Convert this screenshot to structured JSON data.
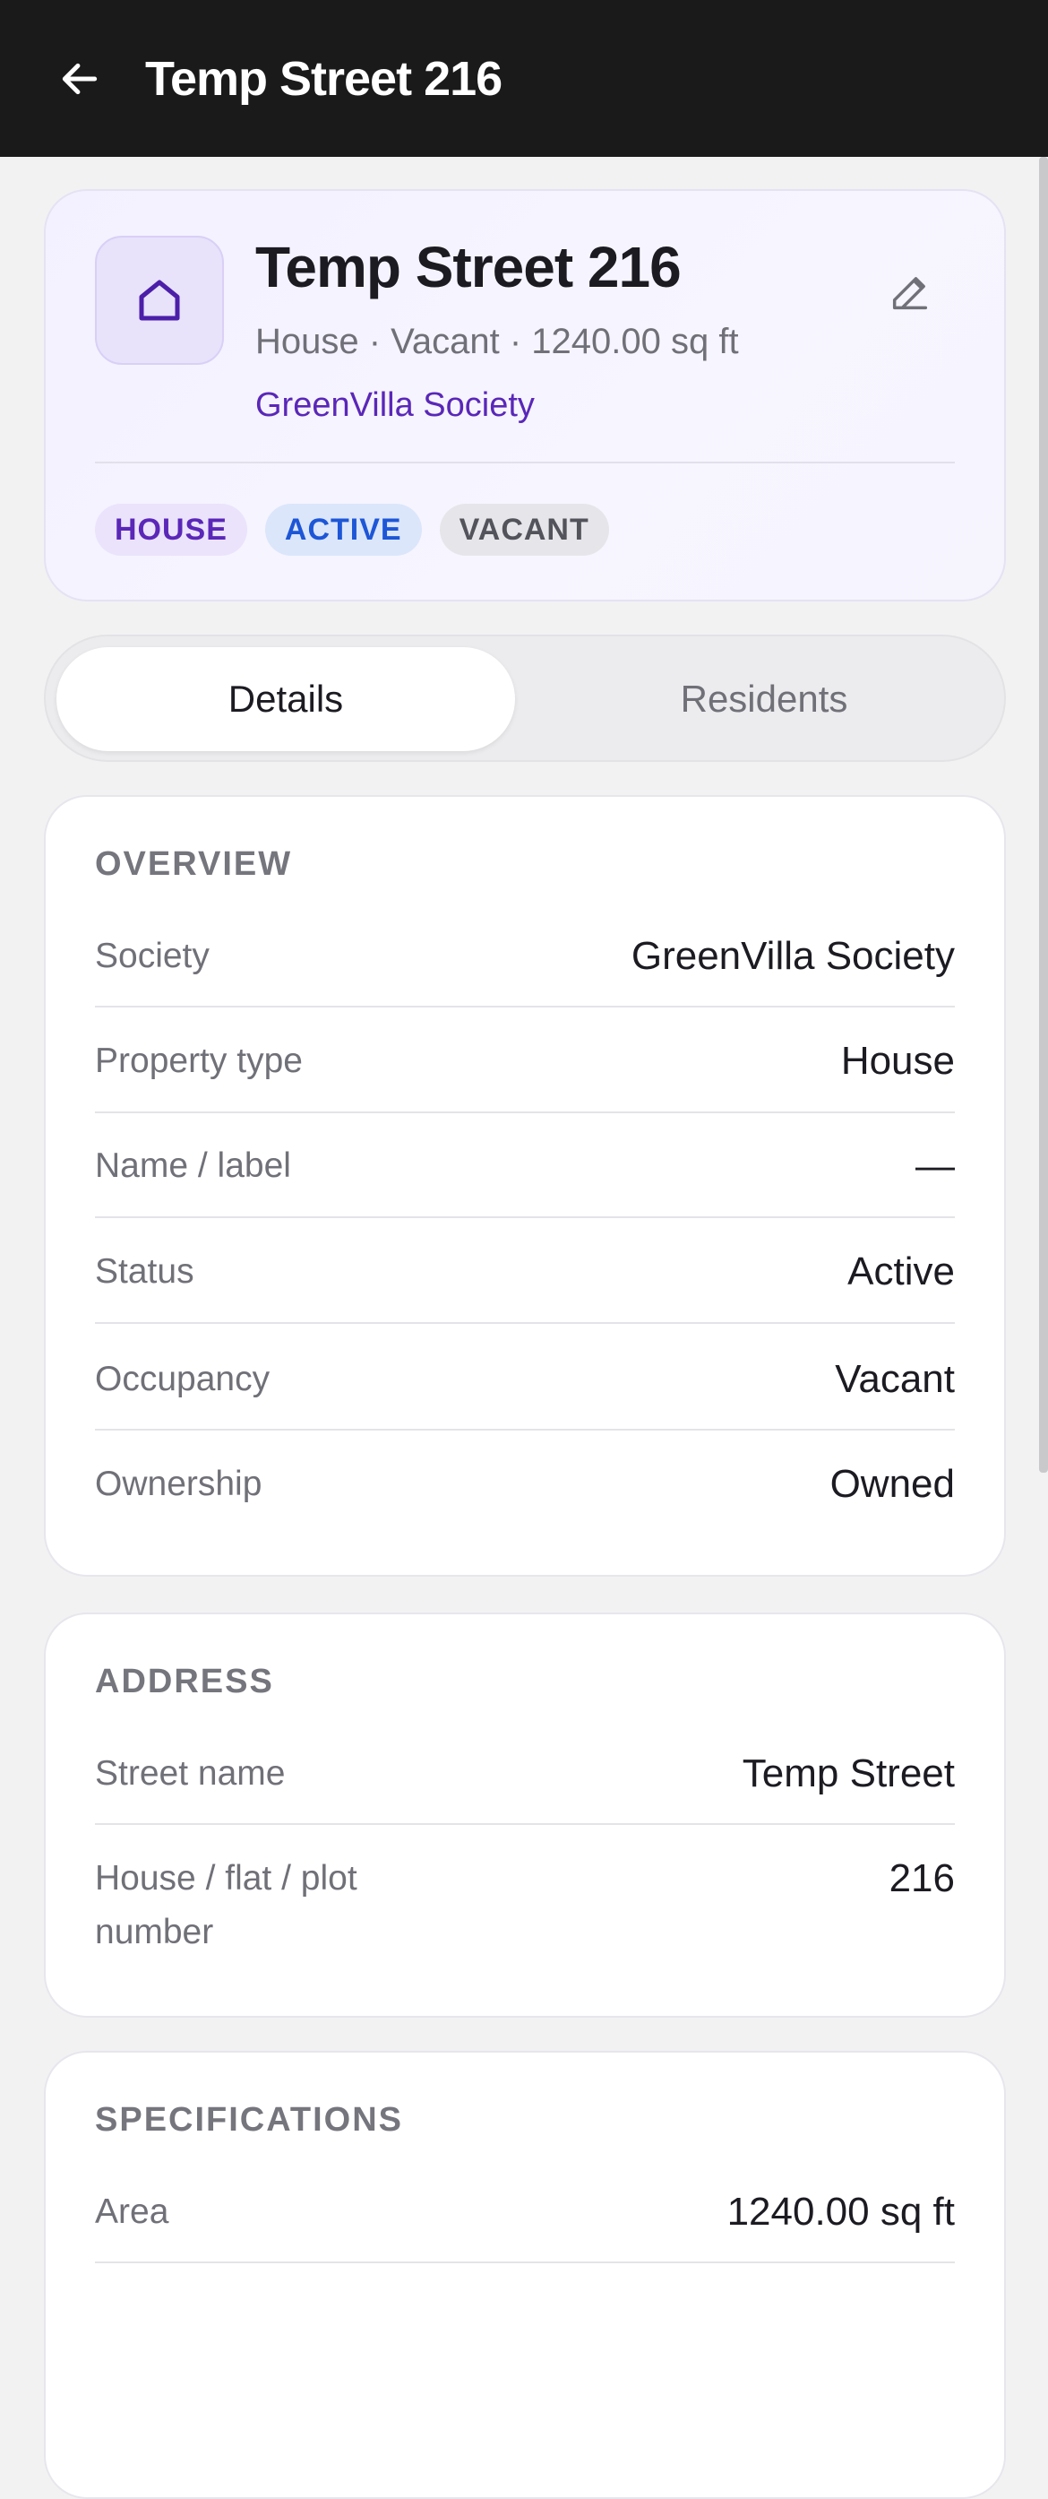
{
  "topbar": {
    "title": "Temp Street 216",
    "back_icon": "arrow-left-icon"
  },
  "hero": {
    "icon": "house-icon",
    "title": "Temp Street 216",
    "subtitle": "House · Vacant · 1240.00 sq ft",
    "society_link": "GreenVilla Society",
    "edit_icon": "pencil-icon",
    "badges": {
      "house": "HOUSE",
      "active": "ACTIVE",
      "vacant": "VACANT"
    }
  },
  "tabs": {
    "details": "Details",
    "residents": "Residents",
    "selected": "Details"
  },
  "overview": {
    "title": "OVERVIEW",
    "rows": [
      {
        "label": "Society",
        "value": "GreenVilla Society"
      },
      {
        "label": "Property type",
        "value": "House"
      },
      {
        "label": "Name / label",
        "value": "—"
      },
      {
        "label": "Status",
        "value": "Active"
      },
      {
        "label": "Occupancy",
        "value": "Vacant"
      },
      {
        "label": "Ownership",
        "value": "Owned"
      }
    ]
  },
  "address": {
    "title": "ADDRESS",
    "rows": [
      {
        "label": "Street name",
        "value": "Temp Street"
      },
      {
        "label": "House / flat / plot number",
        "value": "216"
      }
    ]
  },
  "specifications": {
    "title": "SPECIFICATIONS",
    "rows": [
      {
        "label": "Area",
        "value": "1240.00 sq ft"
      }
    ]
  },
  "colors": {
    "accent": "#5a27b8",
    "topbar": "#1a1a1a",
    "badge_active": "#1d56d6"
  }
}
